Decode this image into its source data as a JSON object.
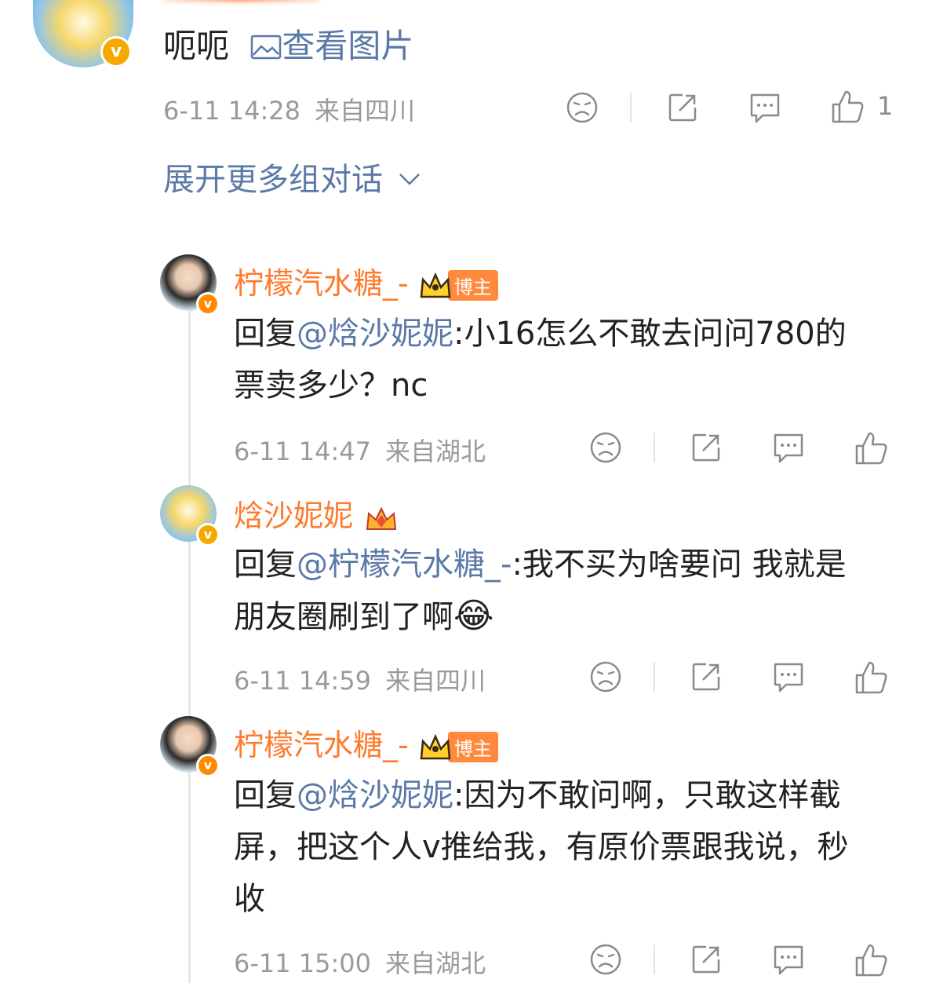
{
  "comment_top": {
    "text": "呃呃",
    "image_link": "查看图片",
    "time": "6-11 14:28",
    "location": "来自四川",
    "like_count": "1"
  },
  "expand_label": "展开更多组对话",
  "replies": [
    {
      "name": "柠檬汽水糖_-",
      "badge": "博主",
      "reply_prefix": "回复",
      "mention": "@焓沙妮妮",
      "content": ":小16怎么不敢去问问780的票卖多少？nc",
      "time": "6-11 14:47",
      "location": "来自湖北"
    },
    {
      "name": "焓沙妮妮",
      "reply_prefix": "回复",
      "mention": "@柠檬汽水糖_-",
      "content": ":我不买为啥要问 我就是朋友圈刷到了啊",
      "emoji": "😂",
      "time": "6-11 14:59",
      "location": "来自四川"
    },
    {
      "name": "柠檬汽水糖_-",
      "badge": "博主",
      "reply_prefix": "回复",
      "mention": "@焓沙妮妮",
      "content": ":因为不敢问啊，只敢这样截屏，把这个人v推给我，有原价票跟我说，秒收",
      "time": "6-11 15:00",
      "location": "来自湖北"
    }
  ],
  "icons": {
    "dislike": "sad-face-icon",
    "share": "share-icon",
    "comment": "comment-icon",
    "like": "thumbs-up-icon"
  },
  "colors": {
    "username": "#ff7a2d",
    "mention": "#5b79a8",
    "meta": "#9a9a9a",
    "badge": "#ff8a3d"
  }
}
